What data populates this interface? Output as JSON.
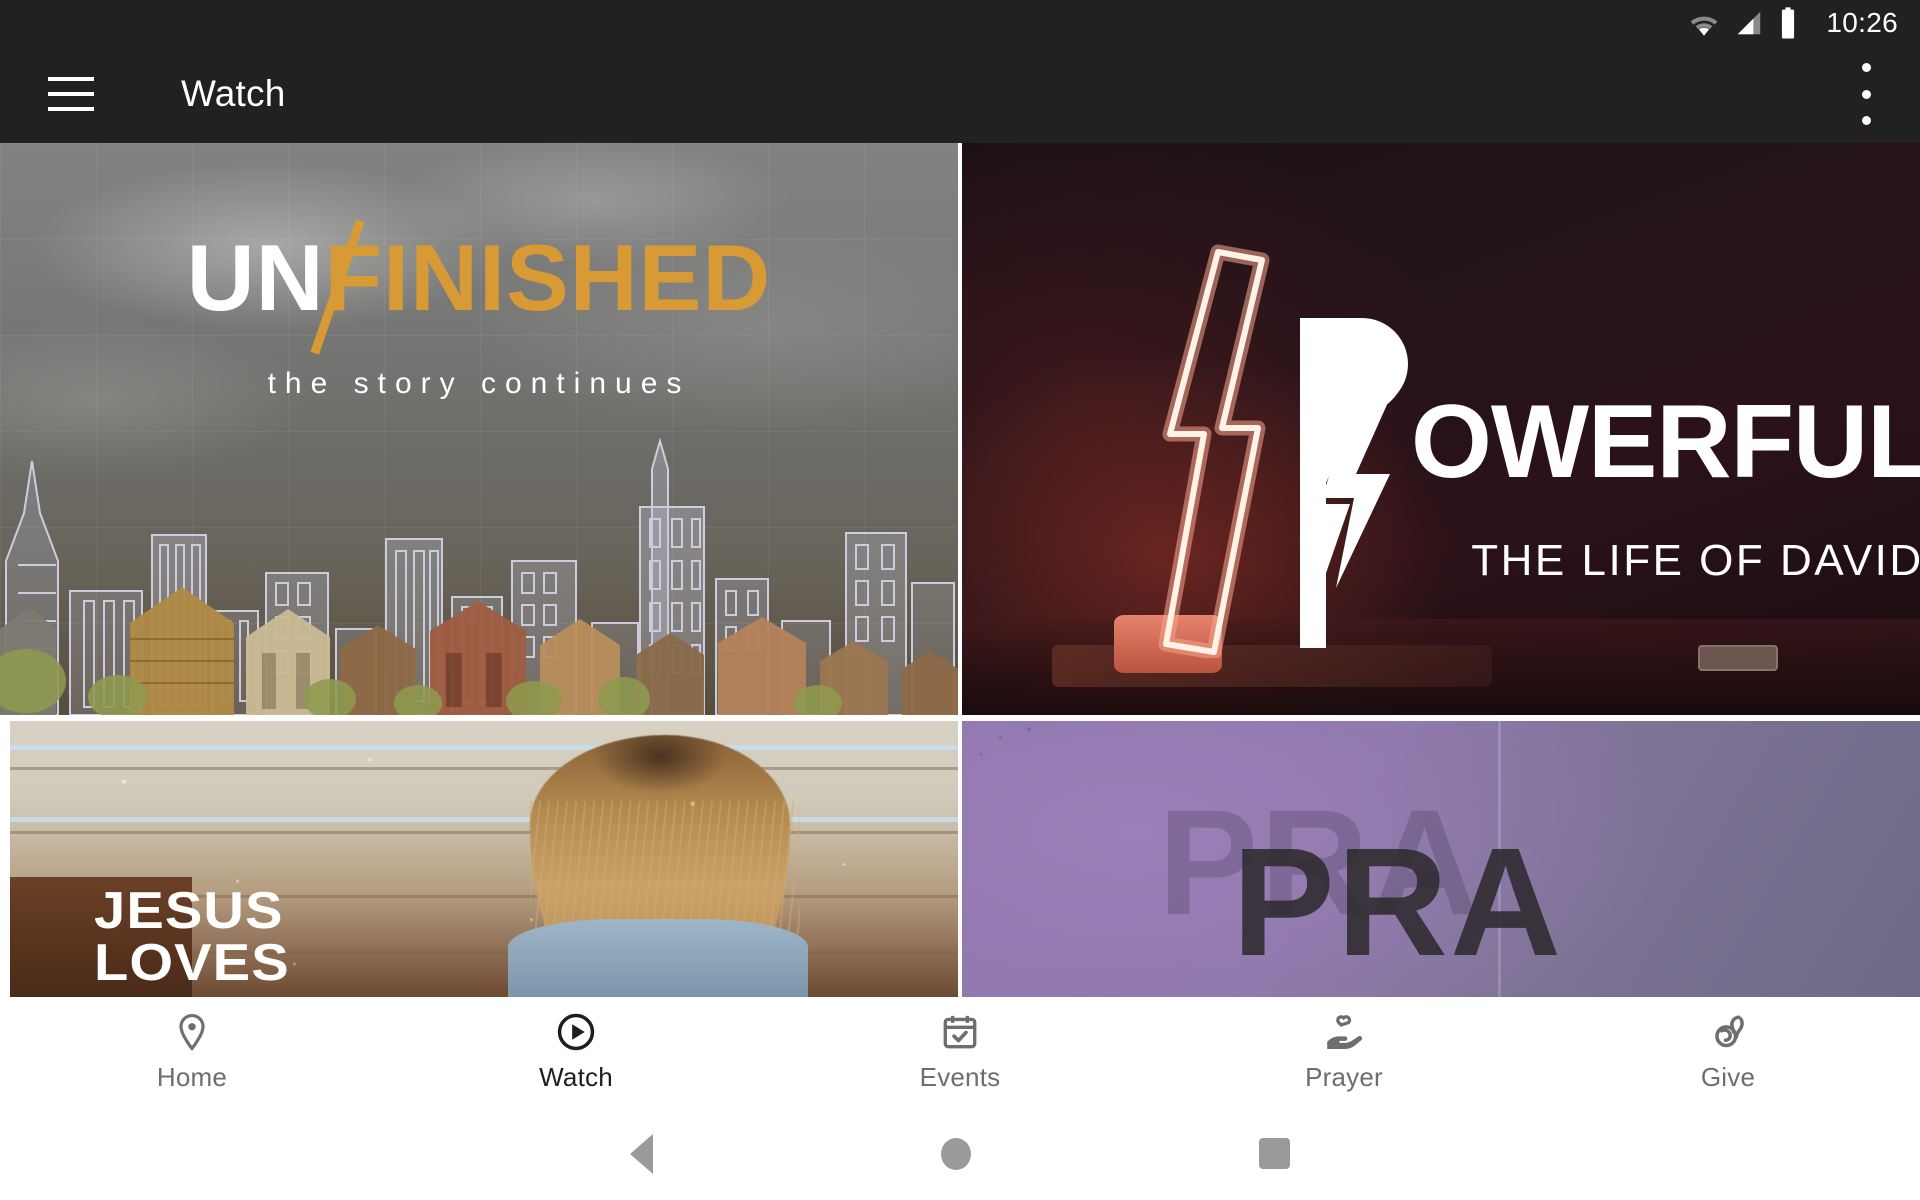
{
  "status_bar": {
    "time": "10:26",
    "icons": [
      "wifi-icon",
      "cellular-signal-icon",
      "battery-icon"
    ]
  },
  "app_bar": {
    "menu_icon": "hamburger-menu-icon",
    "title": "Watch",
    "overflow_icon": "overflow-menu-icon"
  },
  "content": {
    "cards": [
      {
        "id": "unfinished",
        "title_part1": "UN",
        "title_part2": "FINISHED",
        "subtitle": "the story continues",
        "accent_color": "#d79a35",
        "artwork": "city-skyline-blueprint"
      },
      {
        "id": "powerful",
        "title_prefix": "P",
        "title_rest": "OWERFUL",
        "subtitle": "THE LIFE OF DAVID",
        "accent_color": "#e6836c",
        "artwork": "neon-lightning-bolt"
      },
      {
        "id": "jesus-loves",
        "title_line1": "JESUS",
        "title_line2": "LOVES",
        "artwork": "girl-against-siding-wall"
      },
      {
        "id": "pray",
        "title": "PRA",
        "artwork": "purple-textured-paper"
      }
    ]
  },
  "bottom_nav": {
    "items": [
      {
        "label": "Home",
        "icon": "location-pin-icon",
        "active": false
      },
      {
        "label": "Watch",
        "icon": "play-circle-icon",
        "active": true
      },
      {
        "label": "Events",
        "icon": "calendar-check-icon",
        "active": false
      },
      {
        "label": "Prayer",
        "icon": "hand-heart-icon",
        "active": false
      },
      {
        "label": "Give",
        "icon": "give-hand-icon",
        "active": false
      }
    ]
  },
  "system_nav": {
    "back": "back-triangle-icon",
    "home": "home-circle-icon",
    "recents": "recents-square-icon"
  },
  "colors": {
    "app_bar_bg": "#212121",
    "status_bar_bg": "#212121",
    "nav_bg": "#ffffff",
    "nav_inactive": "#6e6e6e",
    "nav_active": "#1e1e1e",
    "system_nav_icon": "#9a9a9a"
  }
}
